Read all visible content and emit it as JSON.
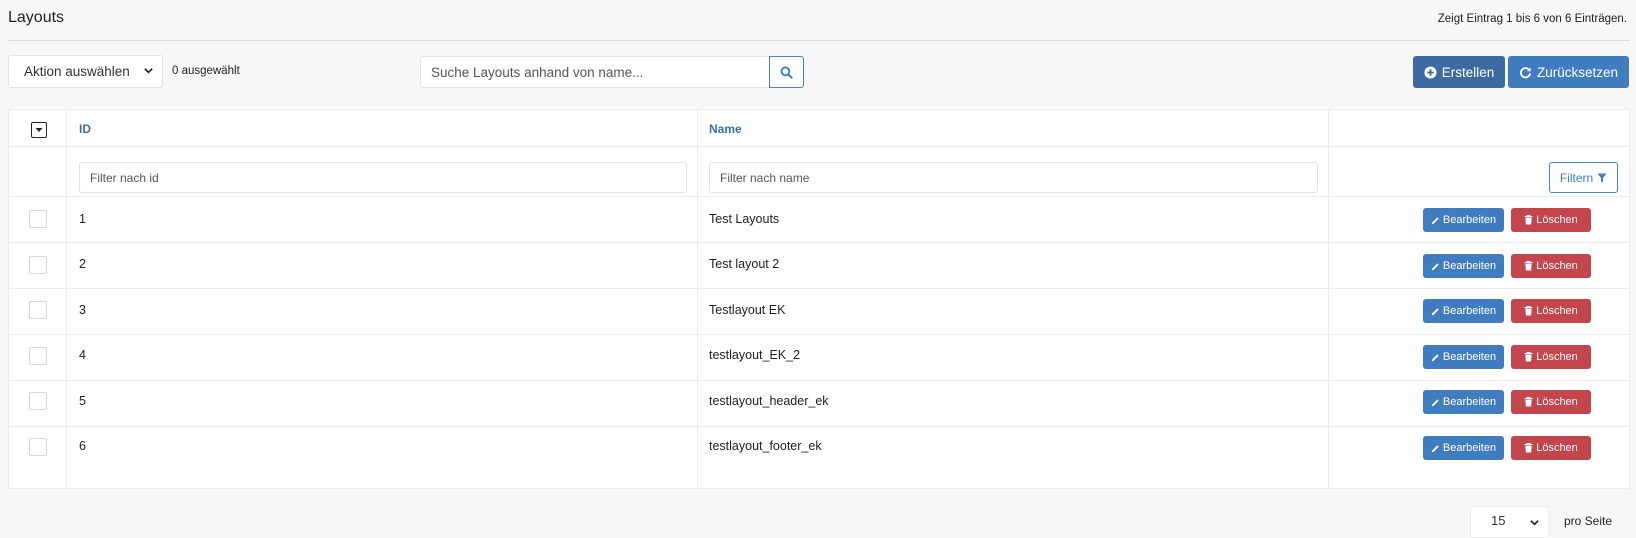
{
  "page": {
    "title": "Layouts",
    "entries_info": "Zeigt Eintrag 1 bis 6 von 6 Einträgen."
  },
  "toolbar": {
    "action_select_value": "Aktion auswählen",
    "selected_count": "0 ausgewählt",
    "search_placeholder": "Suche Layouts anhand von name...",
    "search_value": "",
    "create_label": "Erstellen",
    "reset_label": "Zurücksetzen"
  },
  "table": {
    "columns": {
      "id": "ID",
      "name": "Name"
    },
    "filters": {
      "id_placeholder": "Filter nach id",
      "name_placeholder": "Filter nach name",
      "filter_button_label": "Filtern"
    },
    "edit_label": "Bearbeiten",
    "delete_label": "Löschen",
    "rows": [
      {
        "id": "1",
        "name": "Test Layouts"
      },
      {
        "id": "2",
        "name": "Test layout 2"
      },
      {
        "id": "3",
        "name": "Testlayout EK"
      },
      {
        "id": "4",
        "name": "testlayout_EK_2"
      },
      {
        "id": "5",
        "name": "testlayout_header_ek"
      },
      {
        "id": "6",
        "name": "testlayout_footer_ek"
      }
    ]
  },
  "pagination": {
    "per_page_value": "15",
    "per_page_label": "pro Seite"
  },
  "icons": {
    "action_select_chevron": "chevron-down-icon",
    "search": "search-icon",
    "create": "plus-circle-icon",
    "reset": "refresh-icon",
    "header_checkbox": "caret-down-icon",
    "filter": "funnel-icon",
    "edit": "pencil-icon",
    "delete": "trash-icon"
  },
  "colors": {
    "primary": "#3f7cc0",
    "primary_dark": "#3d6aa0",
    "danger": "#c2464c",
    "header_text": "#3a6ea9"
  }
}
